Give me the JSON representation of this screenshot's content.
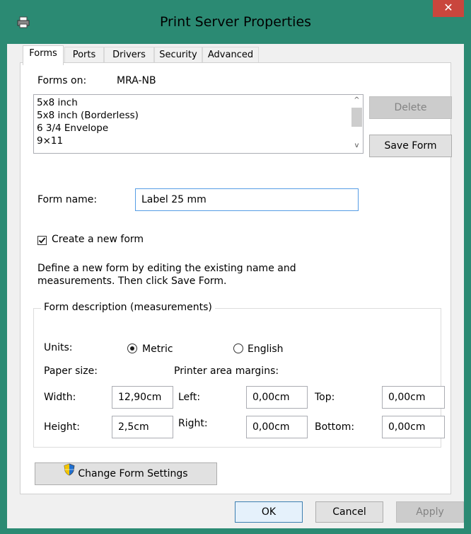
{
  "window": {
    "title": "Print Server Properties",
    "close_symbol": "✕"
  },
  "tabs": [
    {
      "label": "Forms",
      "active": true
    },
    {
      "label": "Ports"
    },
    {
      "label": "Drivers"
    },
    {
      "label": "Security"
    },
    {
      "label": "Advanced"
    }
  ],
  "forms_on": {
    "label": "Forms on:",
    "server": "MRA-NB"
  },
  "forms_list": {
    "items": [
      "5x8 inch",
      "5x8 inch (Borderless)",
      "6 3/4 Envelope",
      "9×11"
    ],
    "scroll_up": "^",
    "scroll_down": "v"
  },
  "buttons": {
    "delete": "Delete",
    "save_form": "Save Form",
    "change_form_settings": "Change Form Settings",
    "ok": "OK",
    "cancel": "Cancel",
    "apply": "Apply"
  },
  "form_name": {
    "label": "Form name:",
    "value": "Label 25 mm"
  },
  "create_new_form": {
    "label": "Create a new form",
    "checked": true
  },
  "instructions": {
    "line1": "Define a new form by editing the existing name and",
    "line2": "measurements. Then click Save Form."
  },
  "description": {
    "title": "Form description (measurements)",
    "units_label": "Units:",
    "metric": "Metric",
    "english": "English",
    "selected_unit": "Metric",
    "paper_size_label": "Paper size:",
    "printer_margins_label": "Printer area margins:",
    "width_label": "Width:",
    "width_value": "12,90cm",
    "height_label": "Height:",
    "height_value": "2,5cm",
    "left_label": "Left:",
    "left_value": "0,00cm",
    "right_label": "Right:",
    "right_value": "0,00cm",
    "top_label": "Top:",
    "top_value": "0,00cm",
    "bottom_label": "Bottom:",
    "bottom_value": "0,00cm"
  },
  "icons": {
    "app": "printer-icon",
    "shield": "shield-icon"
  }
}
